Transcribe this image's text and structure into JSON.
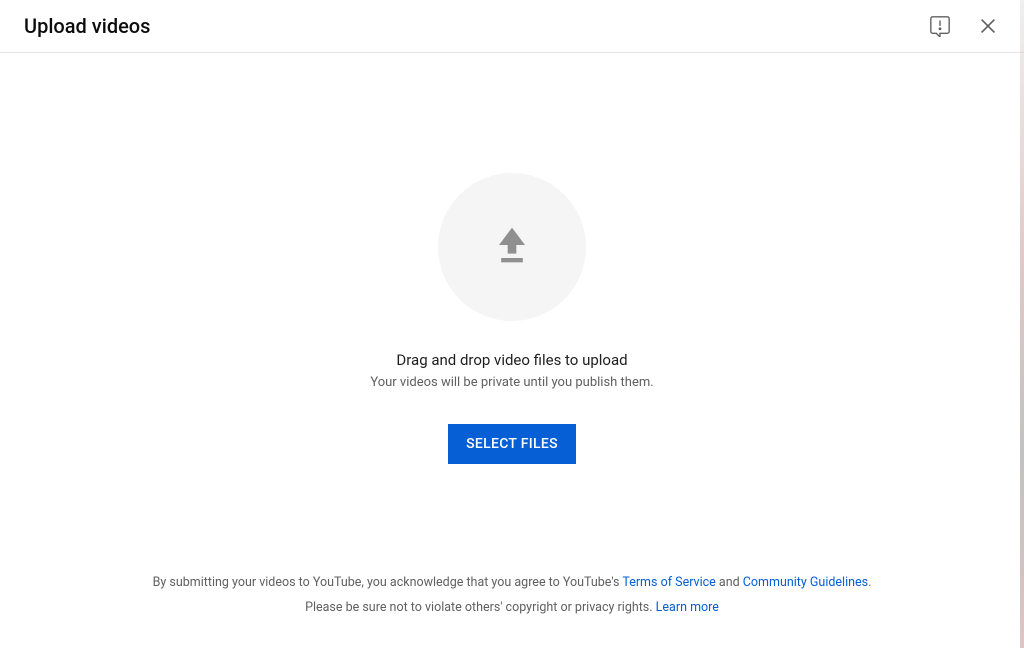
{
  "header": {
    "title": "Upload videos"
  },
  "main": {
    "drag_text": "Drag and drop video files to upload",
    "private_text": "Your videos will be private until you publish them.",
    "select_button": "SELECT FILES"
  },
  "footer": {
    "line1_prefix": "By submitting your videos to YouTube, you acknowledge that you agree to YouTube's ",
    "terms_link": "Terms of Service",
    "line1_and": " and ",
    "community_link": "Community Guidelines",
    "line1_suffix": ".",
    "line2_prefix": "Please be sure not to violate others' copyright or privacy rights. ",
    "learn_more_link": "Learn more"
  }
}
